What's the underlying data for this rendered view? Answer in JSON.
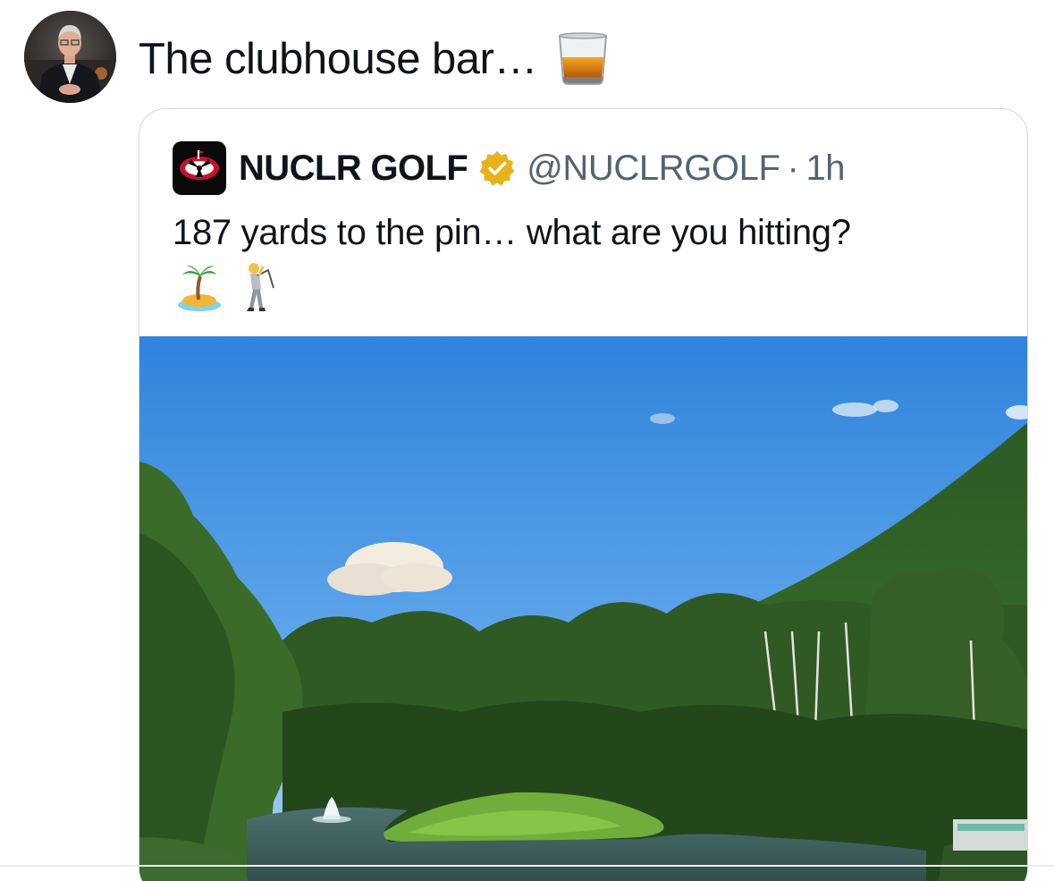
{
  "tweet": {
    "text": "The clubhouse bar…",
    "avatar_icon": "profile-photo",
    "emoji_icon": "tumbler-glass-icon"
  },
  "quoted_tweet": {
    "display_name": "NUCLR GOLF",
    "handle": "@NUCLRGOLF",
    "separator": "·",
    "time": "1h",
    "text": "187 yards to the pin… what are you hitting?",
    "emojis": [
      "desert-island-icon",
      "golfer-icon"
    ],
    "verified": true,
    "media_description_icon": "golf-course-photo"
  },
  "colors": {
    "text_primary": "#0f1419",
    "text_secondary": "#536471",
    "border": "#cfd9de",
    "verified_gold": "#e8b21a"
  }
}
